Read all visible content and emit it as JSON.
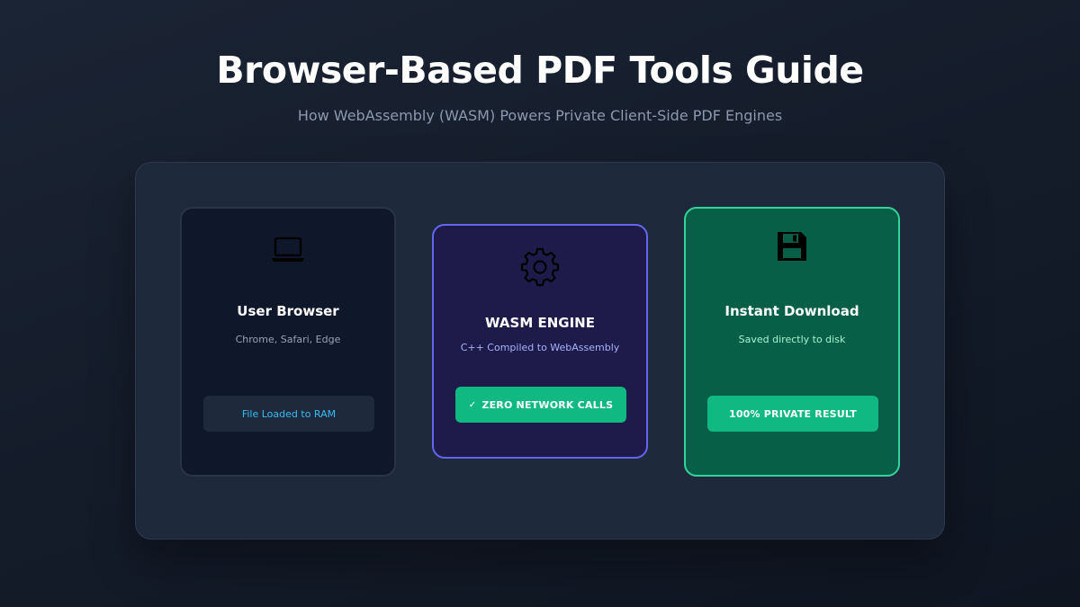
{
  "header": {
    "title": "Browser-Based PDF Tools Guide",
    "subtitle": "How WebAssembly (WASM) Powers Private Client-Side PDF Engines"
  },
  "cards": [
    {
      "icon": "laptop-icon",
      "title": "User Browser",
      "description": "Chrome, Safari, Edge",
      "pill": "File Loaded to RAM"
    },
    {
      "icon": "gear-icon",
      "title": "WASM ENGINE",
      "description": "C++ Compiled to WebAssembly",
      "pill_check": "✓",
      "pill": "ZERO NETWORK CALLS"
    },
    {
      "icon": "floppy-disk-icon",
      "title": "Instant Download",
      "description": "Saved directly to disk",
      "pill": "100% PRIVATE RESULT"
    }
  ],
  "colors": {
    "background": "#161e2c",
    "panel": "#1e293b",
    "browser_card": "#0f172a",
    "wasm_card": "#1e1b4b",
    "wasm_border": "#6366f1",
    "download_card": "#065f46",
    "download_border": "#34d399",
    "accent_green": "#10b981",
    "ram_text": "#38bdf8"
  }
}
